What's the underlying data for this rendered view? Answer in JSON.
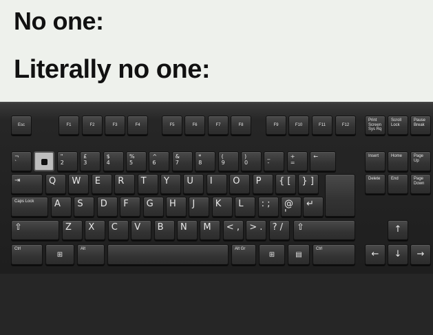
{
  "caption": {
    "line1": "No one:",
    "line2": "Literally no one:"
  },
  "keyboard": {
    "function_row": [
      "Esc",
      "F1",
      "F2",
      "F3",
      "F4",
      "F5",
      "F6",
      "F7",
      "F8",
      "F9",
      "F10",
      "F11",
      "F12",
      "Print Screen Sys Rq",
      "Scroll Lock",
      "Pause Break"
    ],
    "number_row": [
      {
        "top": "¬",
        "bottom": "`",
        "missing": false
      },
      {
        "top": "",
        "bottom": "",
        "missing": true
      },
      {
        "top": "\"",
        "bottom": "2",
        "missing": false
      },
      {
        "top": "£",
        "bottom": "3",
        "missing": false
      },
      {
        "top": "$",
        "bottom": "4",
        "missing": false
      },
      {
        "top": "%",
        "bottom": "5",
        "missing": false
      },
      {
        "top": "^",
        "bottom": "6",
        "missing": false
      },
      {
        "top": "&",
        "bottom": "7",
        "missing": false
      },
      {
        "top": "*",
        "bottom": "8",
        "missing": false
      },
      {
        "top": "(",
        "bottom": "9",
        "missing": false
      },
      {
        "top": ")",
        "bottom": "0",
        "missing": false
      },
      {
        "top": "_",
        "bottom": "-",
        "missing": false
      },
      {
        "top": "+",
        "bottom": "=",
        "missing": false
      },
      {
        "top": "",
        "bottom": "←",
        "missing": false
      }
    ],
    "qwerty_row": [
      "⇥",
      "Q",
      "W",
      "E",
      "R",
      "T",
      "Y",
      "U",
      "I",
      "O",
      "P",
      "{ [",
      "} ]"
    ],
    "home_row": [
      "Caps Lock",
      "A",
      "S",
      "D",
      "F",
      "G",
      "H",
      "J",
      "K",
      "L",
      ": ;",
      "@ '",
      "↵"
    ],
    "shift_row": [
      "⇧",
      "Z",
      "X",
      "C",
      "V",
      "B",
      "N",
      "M",
      "< ,",
      "> .",
      "? /",
      "⇧"
    ],
    "bottom_row": [
      "Ctrl",
      "⊞",
      "Alt",
      "",
      "Alt Gr",
      "⊞",
      "▤",
      "Ctrl"
    ],
    "nav_top": [
      "Insert",
      "Home",
      "Page Up"
    ],
    "nav_bottom": [
      "Delete",
      "End",
      "Page Down"
    ],
    "arrows": [
      "↑",
      "←",
      "↓",
      "→"
    ]
  }
}
